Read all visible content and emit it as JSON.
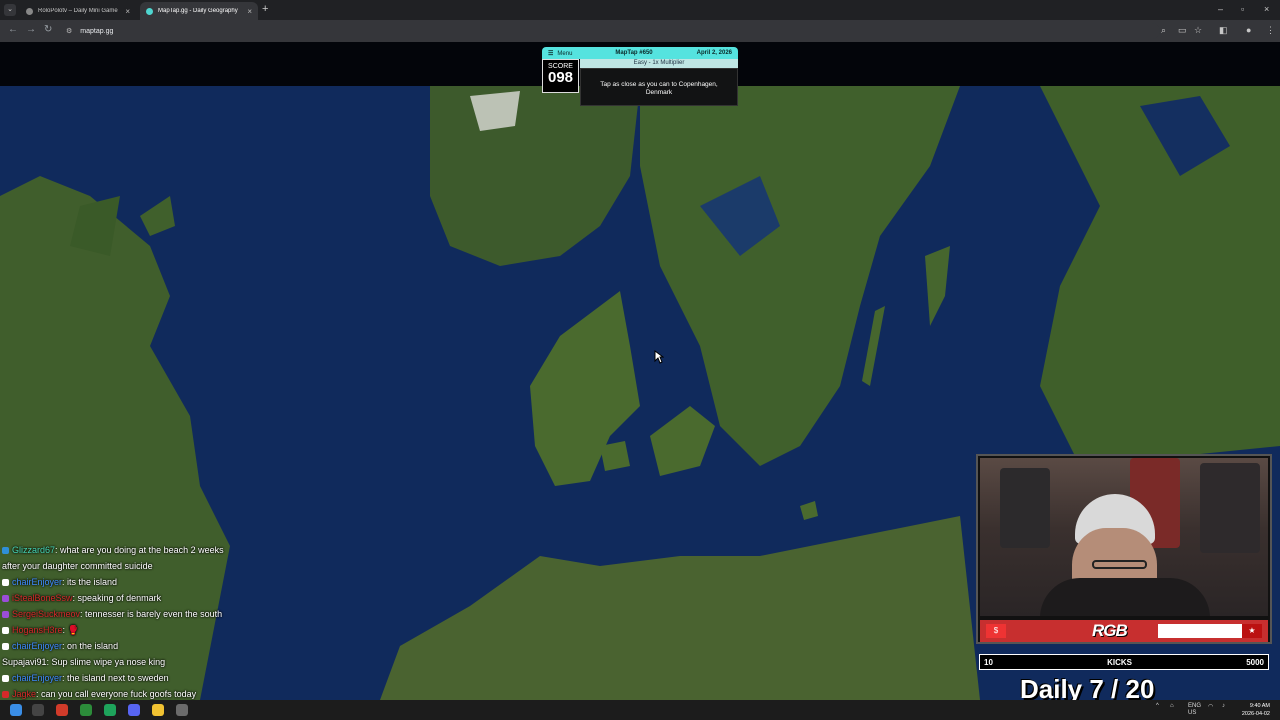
{
  "browser": {
    "tabs": [
      {
        "title": "RoloPolotv – Daily Mini Game"
      },
      {
        "title": "MapTap.gg - Daily Geography"
      }
    ],
    "url": "maptap.gg"
  },
  "game": {
    "menu_label": "Menu",
    "game_number": "MapTap #650",
    "date": "April 2, 2026",
    "score_label": "SCORE",
    "score_value": "098",
    "difficulty": "Easy - 1x Multiplier",
    "prompt": "Tap as close as you can to Copenhagen, Denmark"
  },
  "chat": [
    {
      "user": "Glizzard67",
      "user_color": "#46d6b5",
      "badge": "#2f8fd8",
      "message": ": what are you doing at the beach 2 weeks after your daughter committed suicide"
    },
    {
      "user": "chairEnjoyer",
      "user_color": "#3f8cff",
      "badge": "#ffffff",
      "message": ": its the island"
    },
    {
      "user": "iStealBoneSsw",
      "user_color": "#d42a2a",
      "badge": "#9b4dd8",
      "message": ": speaking of denmark"
    },
    {
      "user": "SergeiSuckmeov",
      "user_color": "#d42a2a",
      "badge": "#9b4dd8",
      "message": ": tennesser is barely even the south"
    },
    {
      "user": "HogansH3re",
      "user_color": "#d42a2a",
      "badge": "#ffffff",
      "message": ": 🥊"
    },
    {
      "user": "chairEnjoyer",
      "user_color": "#3f8cff",
      "badge": "#ffffff",
      "message": ": on the island"
    },
    {
      "user": "Supajavi91",
      "user_color": "#ffffff",
      "badge": "",
      "message": ": Sup slime wipe ya nose king"
    },
    {
      "user": "chairEnjoyer",
      "user_color": "#3f8cff",
      "badge": "#ffffff",
      "message": ": the island next to sweden"
    },
    {
      "user": "Jagke",
      "user_color": "#d42a2a",
      "badge": "#d42a2a",
      "message": ": can you call everyone fuck goofs today"
    }
  ],
  "stream": {
    "goal_current": "10",
    "goal_label": "KICKS",
    "goal_target": "5000",
    "daily_text": "Daily 7 / 20",
    "logo_text": "RGB"
  },
  "taskbar": {
    "time": "9:40 AM",
    "date": "2026-04-02",
    "locale": "ENG US"
  },
  "colors": {
    "hud_accent": "#55e3df",
    "ocean": "#0e2452",
    "land": "#3f5a2a"
  }
}
